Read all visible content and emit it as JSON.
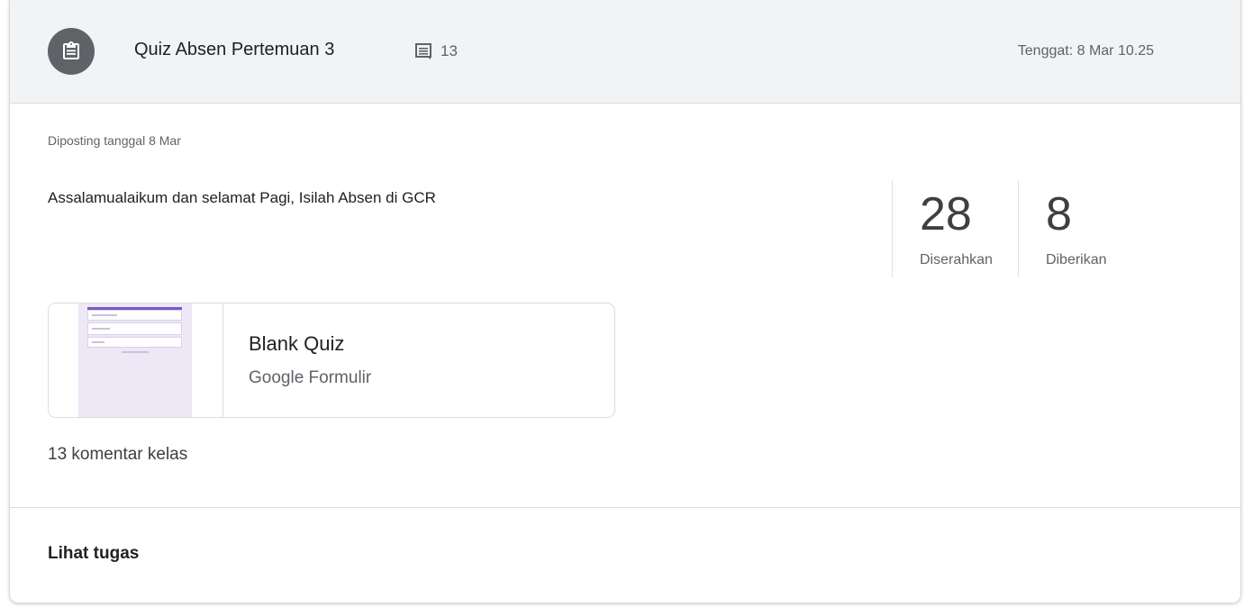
{
  "header": {
    "title": "Quiz Absen Pertemuan 3",
    "comment_count": "13",
    "due": "Tenggat: 8 Mar 10.25",
    "icon": "assignment-icon",
    "comment_icon": "comment-icon"
  },
  "body": {
    "posted": "Diposting tanggal 8 Mar",
    "instructions": "Assalamualaikum dan selamat Pagi, Isilah Absen di GCR"
  },
  "stats": [
    {
      "value": "28",
      "label": "Diserahkan"
    },
    {
      "value": "8",
      "label": "Diberikan"
    }
  ],
  "attachment": {
    "title": "Blank Quiz",
    "type": "Google Formulir"
  },
  "class_comments": "13 komentar kelas",
  "footer": {
    "view_label": "Lihat tugas"
  },
  "colors": {
    "header_bg": "#f1f3f4",
    "icon_bg": "#5f6368",
    "form_accent": "#7e57c2"
  }
}
